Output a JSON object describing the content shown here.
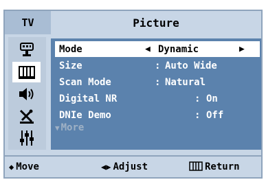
{
  "header": {
    "tab_label": "TV",
    "title": "Picture"
  },
  "sidebar": {
    "items": [
      {
        "icon": "input-icon",
        "active": false
      },
      {
        "icon": "picture-icon",
        "active": true
      },
      {
        "icon": "sound-icon",
        "active": false
      },
      {
        "icon": "channel-icon",
        "active": false
      },
      {
        "icon": "setup-icon",
        "active": false
      }
    ]
  },
  "menu": {
    "mode": {
      "label": "Mode",
      "value": "Dynamic"
    },
    "size": {
      "label": "Size",
      "value": "Auto Wide"
    },
    "scan_mode": {
      "label": "Scan Mode",
      "value": "Natural"
    },
    "digital_nr": {
      "label": "Digital NR",
      "value": "On"
    },
    "dnie_demo": {
      "label": "DNIe Demo",
      "value": "Off"
    },
    "more_label": "More"
  },
  "footer": {
    "move_label": "Move",
    "adjust_label": "Adjust",
    "return_label": "Return"
  },
  "colors": {
    "panel": "#5b82ad",
    "frame": "#c8d6e6",
    "selected_row": "#ffffff"
  }
}
